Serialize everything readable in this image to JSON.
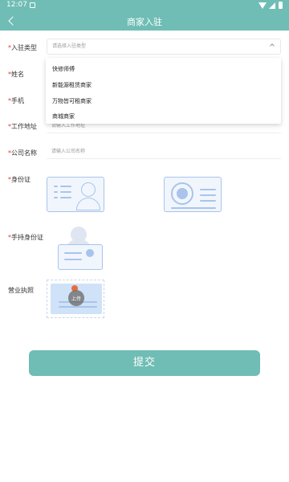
{
  "status_bar": {
    "time": "12:07"
  },
  "header": {
    "title": "商家入驻"
  },
  "form": {
    "type": {
      "label": "入驻类型",
      "placeholder": "请选择入驻类型"
    },
    "name": {
      "label": "姓名"
    },
    "phone": {
      "label": "手机"
    },
    "address": {
      "label": "工作地址",
      "placeholder": "请输入工作地址"
    },
    "company": {
      "label": "公司名称",
      "placeholder": "请输入公司名称"
    },
    "id_card": {
      "label": "身份证"
    },
    "hand_id": {
      "label": "手持身份证"
    },
    "license": {
      "label": "营业执照",
      "upload_label": "上传"
    }
  },
  "dropdown": {
    "options": [
      "快修师傅",
      "新能源租赁商家",
      "万物皆可租商家",
      "商城商家"
    ]
  },
  "submit_label": "提交",
  "colors": {
    "primary": "#6fbdb5",
    "required": "#e53935",
    "card": "#a9c4ec"
  }
}
